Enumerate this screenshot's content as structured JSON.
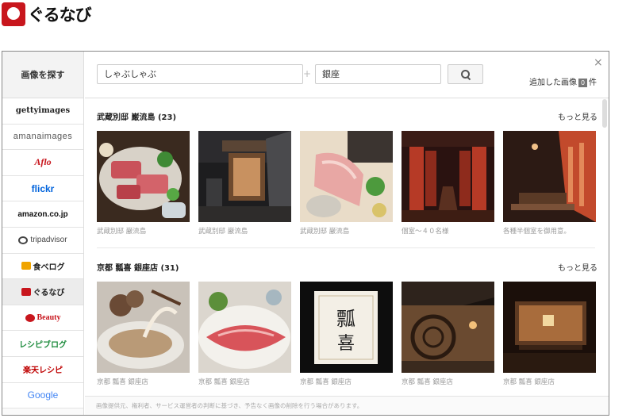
{
  "brand": {
    "logo_text": "ぐるなび",
    "color": "#c8161d"
  },
  "sidebar": {
    "title": "画像を探す",
    "items": [
      {
        "label": "gettyimages",
        "icon": "getty-logo"
      },
      {
        "label": "amanaimages",
        "icon": "amana-logo"
      },
      {
        "label": "Aflo",
        "icon": "aflo-logo"
      },
      {
        "label": "flickr",
        "icon": "flickr-logo"
      },
      {
        "label": "amazon.co.jp",
        "icon": "amazon-logo"
      },
      {
        "label": "tripadvisor",
        "icon": "tripadvisor-owl-icon"
      },
      {
        "label": "食べログ",
        "icon": "tabelog-icon"
      },
      {
        "label": "ぐるなび",
        "icon": "gurunavi-icon",
        "active": true
      },
      {
        "label": "Beauty",
        "icon": "beauty-logo"
      },
      {
        "label": "レシピブログ",
        "icon": "recipe-blog-logo"
      },
      {
        "label": "楽天レシピ",
        "icon": "rakuten-recipe-logo"
      },
      {
        "label": "Google",
        "icon": "google-logo"
      }
    ]
  },
  "search": {
    "keyword": "しゃぶしゃぶ",
    "plus": "+",
    "location": "銀座",
    "button_icon": "search-icon"
  },
  "dialog": {
    "close": "×",
    "added_prefix": "追加した画像",
    "added_count": "0",
    "added_suffix": "件"
  },
  "groups": [
    {
      "title": "武蔵別邸 巌流島 (23)",
      "more": "もっと見る",
      "items": [
        {
          "caption": "武蔵別邸 巌流島"
        },
        {
          "caption": "武蔵別邸 巌流島"
        },
        {
          "caption": "武蔵別邸 巌流島"
        },
        {
          "caption": "個室～４０名様"
        },
        {
          "caption": "各種半個室を御用意。"
        }
      ]
    },
    {
      "title": "京都 瓢喜 銀座店 (31)",
      "more": "もっと見る",
      "items": [
        {
          "caption": "京都 瓢喜 銀座店"
        },
        {
          "caption": "京都 瓢喜 銀座店"
        },
        {
          "caption": "京都 瓢喜 銀座店"
        },
        {
          "caption": "京都 瓢喜 銀座店"
        },
        {
          "caption": "京都 瓢喜 銀座店"
        }
      ]
    }
  ],
  "footer": {
    "notice": "画像提供元、権利者、サービス運営者の判断に基づき、予告なく画像の削除を行う場合があります。"
  }
}
